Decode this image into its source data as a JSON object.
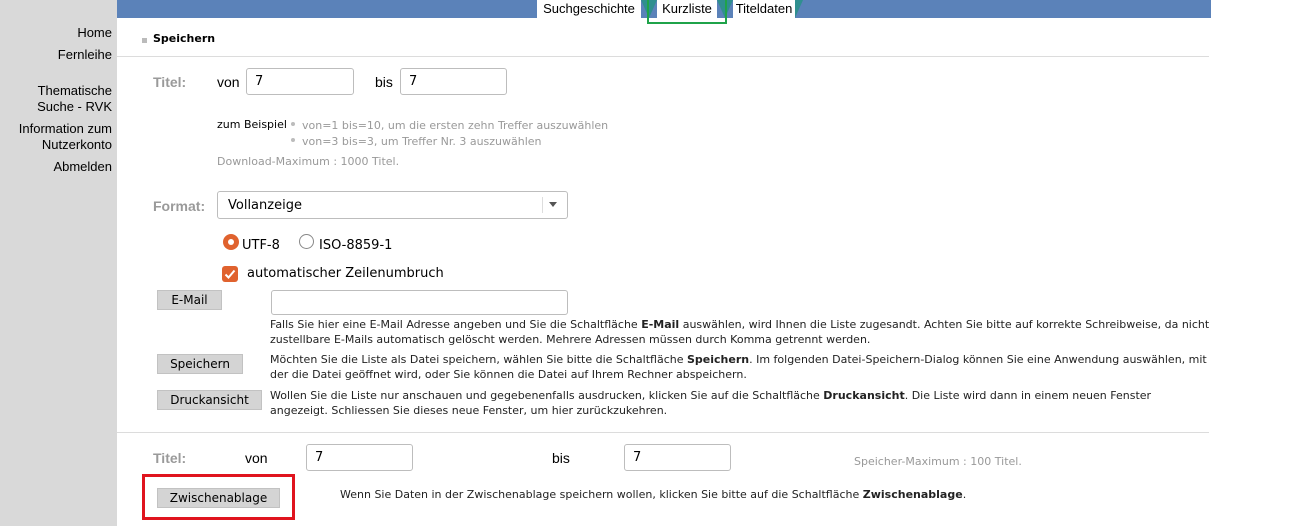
{
  "sidebar": {
    "items": [
      {
        "label": "Home"
      },
      {
        "label": "Fernleihe"
      },
      {
        "label": "Thematische"
      },
      {
        "label": "Suche - RVK"
      },
      {
        "label": "Information zum"
      },
      {
        "label": "Nutzerkonto"
      },
      {
        "label": "Abmelden"
      }
    ]
  },
  "tabs": [
    {
      "label": "Suchgeschichte"
    },
    {
      "label": "Kurzliste"
    },
    {
      "label": "Titeldaten"
    }
  ],
  "section_title": "Speichern",
  "titel_range": {
    "label": "Titel:",
    "von_label": "von",
    "von_value": "7",
    "bis_label": "bis",
    "bis_value": "7"
  },
  "example": {
    "label": "zum Beispiel",
    "lines": [
      "von=1 bis=10, um die ersten zehn Treffer auszuwählen",
      "von=3 bis=3, um Treffer Nr. 3 auszuwählen"
    ],
    "download_max": "Download-Maximum : 1000 Titel."
  },
  "format": {
    "label": "Format:",
    "selected": "Vollanzeige"
  },
  "encoding": {
    "options": [
      "UTF-8",
      "ISO-8859-1"
    ],
    "selected": "UTF-8"
  },
  "line_wrap": {
    "label": "automatischer Zeilenumbruch",
    "checked": true
  },
  "email": {
    "button": "E-Mail",
    "value": "",
    "desc_pre": "Falls Sie hier eine E-Mail Adresse angeben und Sie die Schaltfläche ",
    "desc_bold": "E-Mail",
    "desc_post": " auswählen, wird Ihnen die Liste zugesandt. Achten Sie bitte auf korrekte Schreibweise, da nicht zustellbare E-Mails automatisch gelöscht werden. Mehrere Adressen müssen durch Komma getrennt werden."
  },
  "save": {
    "button": "Speichern",
    "desc_pre": "Möchten Sie die Liste als Datei speichern, wählen Sie bitte die Schaltfläche ",
    "desc_bold": "Speichern",
    "desc_post": ". Im folgenden Datei-Speichern-Dialog können Sie eine Anwendung auswählen, mit der die Datei geöffnet wird, oder Sie können die Datei auf Ihrem Rechner abspeichern."
  },
  "print": {
    "button": "Druckansicht",
    "desc_pre": "Wollen Sie die Liste nur anschauen und gegebenenfalls ausdrucken, klicken Sie auf die Schaltfläche ",
    "desc_bold": "Druckansicht",
    "desc_post": ". Die Liste wird dann in einem neuen Fenster angezeigt. Schliessen Sie dieses neue Fenster, um hier zurückzukehren."
  },
  "clipboard_range": {
    "label": "Titel:",
    "von_label": "von",
    "von_value": "7",
    "bis_label": "bis",
    "bis_value": "7",
    "max": "Speicher-Maximum : 100 Titel."
  },
  "clipboard": {
    "button": "Zwischenablage",
    "desc_pre": "Wenn Sie Daten in der Zwischenablage speichern wollen, klicken Sie bitte auf die Schaltfläche ",
    "desc_bold": "Zwischenablage",
    "desc_post": "."
  },
  "colors": {
    "topbar": "#5b82b9",
    "sidebar": "#d9d9d9",
    "tab_accent": "#2f8f8f",
    "radio_checkbox": "#e0622e",
    "highlight_green": "#1fa34a",
    "highlight_red": "#e0141e"
  }
}
